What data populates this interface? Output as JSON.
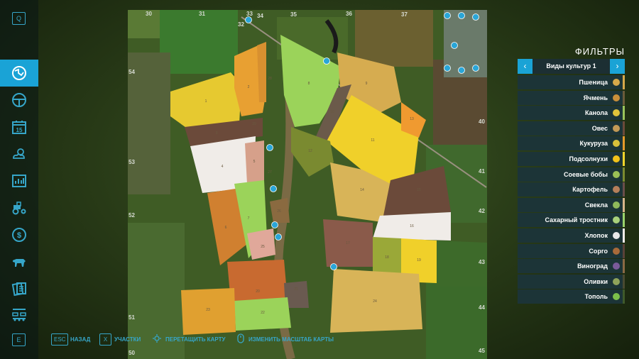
{
  "sidebar": {
    "top_key": "Q",
    "bottom_key": "E",
    "items": [
      {
        "icon": "map-icon"
      },
      {
        "icon": "steering-wheel-icon"
      },
      {
        "icon": "calendar-icon",
        "text": "15"
      },
      {
        "icon": "weather-icon"
      },
      {
        "icon": "statistics-icon"
      },
      {
        "icon": "tractor-icon"
      },
      {
        "icon": "finance-icon"
      },
      {
        "icon": "animals-icon"
      },
      {
        "icon": "contracts-icon"
      },
      {
        "icon": "production-icon"
      }
    ]
  },
  "map": {
    "grid_top": [
      "30",
      "31",
      "33",
      "34",
      "35",
      "36",
      "37"
    ],
    "grid_left": [
      "54",
      "53",
      "52",
      "51"
    ],
    "grid_right": [
      "40",
      "41",
      "42",
      "43",
      "44"
    ],
    "grid_extra": [
      "32"
    ],
    "grid_bottom": [
      "50",
      "45"
    ],
    "field_numbers": [
      "1",
      "2",
      "3",
      "4",
      "5",
      "6",
      "7",
      "8",
      "9",
      "10",
      "11",
      "12",
      "13",
      "14",
      "15",
      "16",
      "17",
      "18",
      "19",
      "20",
      "21",
      "22",
      "23",
      "24",
      "25",
      "26",
      "27",
      "28",
      "29"
    ]
  },
  "filters": {
    "title": "ФИЛЬТРЫ",
    "selector_label": "Виды культур 1",
    "prev": "‹",
    "next": "›",
    "crops": [
      {
        "name": "Пшеница",
        "color": "#d6a84a",
        "bar": "#d6a84a"
      },
      {
        "name": "Ячмень",
        "color": "#c98f3a",
        "bar": "#6b5b3a"
      },
      {
        "name": "Канола",
        "color": "#e0c33a",
        "bar": "#9bc45a"
      },
      {
        "name": "Овес",
        "color": "#c29a56",
        "bar": "#6b4a3a"
      },
      {
        "name": "Кукуруза",
        "color": "#d8c03a",
        "bar": "#e59a2a"
      },
      {
        "name": "Подсолнухи",
        "color": "#f2c21a",
        "bar": "#f2d42a"
      },
      {
        "name": "Соевые бобы",
        "color": "#9bbf55",
        "bar": "#7c8a30"
      },
      {
        "name": "Картофель",
        "color": "#b57f5a",
        "bar": "#6a4e4a"
      },
      {
        "name": "Свекла",
        "color": "#8fb85a",
        "bar": "#d6b58a"
      },
      {
        "name": "Сахарный тростник",
        "color": "#a8d07a",
        "bar": "#9bd36a"
      },
      {
        "name": "Хлопок",
        "color": "#e8e8e8",
        "bar": "#f0ece8"
      },
      {
        "name": "Сорго",
        "color": "#a86a3a",
        "bar": "#5a4238"
      },
      {
        "name": "Виноград",
        "color": "#7a5a9a",
        "bar": "#8a6a44"
      },
      {
        "name": "Оливки",
        "color": "#8fa35a",
        "bar": "#4a4a30"
      },
      {
        "name": "Тополь",
        "color": "#7cbf4a",
        "bar": "#3f5a2a"
      }
    ]
  },
  "bottom": {
    "back_key": "ESC",
    "back_label": "НАЗАД",
    "fields_key": "X",
    "fields_label": "УЧАСТКИ",
    "drag_label": "ПЕРЕТАЩИТЬ КАРТУ",
    "zoom_label": "ИЗМЕНИТЬ МАСШТАБ КАРТЫ"
  }
}
